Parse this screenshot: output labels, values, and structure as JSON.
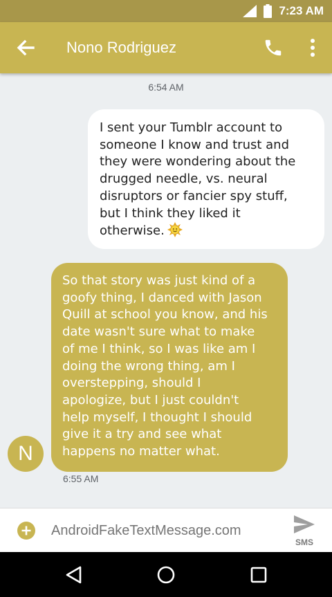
{
  "status_bar": {
    "time": "7:23 AM",
    "icons": [
      "signal-icon",
      "battery-icon"
    ]
  },
  "app_bar": {
    "contact_name": "Nono Rodriguez",
    "icons": [
      "back-arrow-icon",
      "phone-icon",
      "more-vert-icon"
    ]
  },
  "conversation": {
    "messages": [
      {
        "timestamp": "6:54 AM",
        "direction": "outgoing",
        "text": "I sent your Tumblr account to\nsomeone I know and trust and\nthey were wondering about the\ndrugged needle, vs. neural\ndisruptors or fancier spy stuff,\nbut I think they liked it\notherwise.",
        "emoji": "smiling-sun-emoji"
      },
      {
        "direction": "incoming",
        "text": "So that story was just kind of a\ngoofy thing, I danced with Jason\nQuill at school you know, and his\ndate wasn't sure what to make\nof me I think, so I was like am I\ndoing the wrong thing, am I\noverstepping, should I\napologize, but I just couldn't\nhelp myself, I thought I should\ngive it a try and see what\nhappens no matter what.",
        "avatar_initial": "N",
        "timestamp": "6:55 AM"
      }
    ]
  },
  "compose": {
    "placeholder": "AndroidFakeTextMessage.com",
    "send_label": "SMS",
    "icons": [
      "add-circle-icon",
      "send-icon"
    ]
  },
  "nav_bar": {
    "icons": [
      "nav-back-icon",
      "nav-home-icon",
      "nav-recents-icon"
    ]
  },
  "colors": {
    "status_bar": "#a8974a",
    "accent": "#c8b552",
    "background": "#eceff1",
    "outgoing_bubble": "#ffffff",
    "incoming_text": "#ffffff"
  }
}
